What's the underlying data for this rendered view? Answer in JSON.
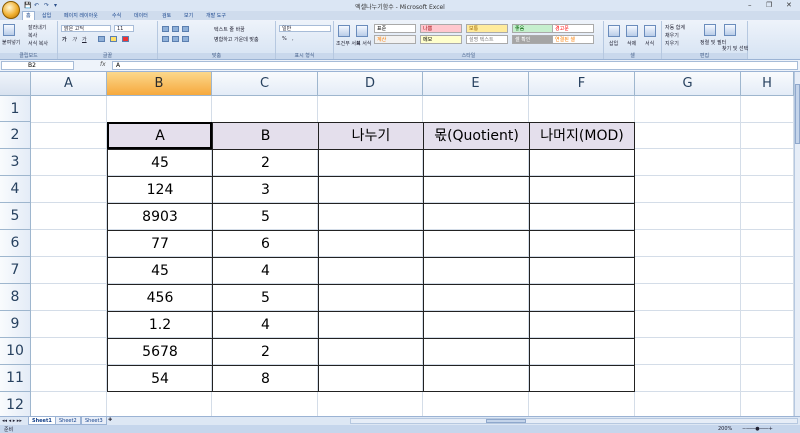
{
  "window": {
    "title": "엑셀나누기함수 - Microsoft Excel",
    "controls": [
      "–",
      "❐",
      "✕"
    ]
  },
  "quick_access": [
    "💾",
    "↶",
    "↷",
    "▾"
  ],
  "ribbon_tabs": [
    "홈",
    "삽입",
    "페이지 레이아웃",
    "수식",
    "데이터",
    "검토",
    "보기",
    "개발 도구"
  ],
  "active_tab": "홈",
  "ribbon": {
    "clipboard": {
      "label": "클립보드",
      "paste": "붙여넣기",
      "cut": "잘라내기",
      "copy": "복사",
      "format_painter": "서식 복사"
    },
    "font": {
      "label": "글꼴",
      "font_name": "맑은 고딕",
      "font_size": "11",
      "bold": "가",
      "italic": "가",
      "underline": "가"
    },
    "alignment": {
      "label": "맞춤",
      "wrap": "텍스트 줄 바꿈",
      "merge": "병합하고 가운데 맞춤"
    },
    "number": {
      "label": "표시 형식",
      "format": "일반",
      "percent": "%",
      "comma": ","
    },
    "styles": {
      "label": "스타일",
      "conditional": "조건부 서식",
      "table": "표 서식",
      "cells": [
        {
          "text": "표준",
          "bg": "#ffffff",
          "fg": "#000000"
        },
        {
          "text": "나쁨",
          "bg": "#ffc7ce",
          "fg": "#9c0006"
        },
        {
          "text": "보통",
          "bg": "#ffeb9c",
          "fg": "#9c6500"
        },
        {
          "text": "좋음",
          "bg": "#c6efce",
          "fg": "#006100"
        },
        {
          "text": "경고문",
          "bg": "#ffffff",
          "fg": "#ff0000"
        },
        {
          "text": "계산",
          "bg": "#f2f2f2",
          "fg": "#fa7d00"
        },
        {
          "text": "메모",
          "bg": "#ffffcc",
          "fg": "#000000"
        },
        {
          "text": "설명 텍스트",
          "bg": "#ffffff",
          "fg": "#7f7f7f"
        },
        {
          "text": "셀 확인",
          "bg": "#a5a5a5",
          "fg": "#ffffff"
        },
        {
          "text": "연결된 셀",
          "bg": "#ffffff",
          "fg": "#fa7d00"
        }
      ]
    },
    "cells": {
      "label": "셀",
      "insert": "삽입",
      "delete": "삭제",
      "format": "서식"
    },
    "editing": {
      "label": "편집",
      "autosum": "자동 합계",
      "fill": "채우기",
      "clear": "지우기",
      "sort": "정렬 및 필터",
      "find": "찾기 및 선택"
    }
  },
  "formula_bar": {
    "name_box": "B2",
    "fx": "fx",
    "formula": "A"
  },
  "columns": [
    "A",
    "B",
    "C",
    "D",
    "E",
    "F",
    "G",
    "H"
  ],
  "selected_column": "B",
  "rows": [
    "1",
    "2",
    "3",
    "4",
    "5",
    "6",
    "7",
    "8",
    "9",
    "10",
    "11",
    "12"
  ],
  "table": {
    "headers": [
      "A",
      "B",
      "나누기",
      "몫(Quotient)",
      "나머지(MOD)"
    ],
    "rows": [
      [
        "45",
        "2",
        "",
        "",
        ""
      ],
      [
        "124",
        "3",
        "",
        "",
        ""
      ],
      [
        "8903",
        "5",
        "",
        "",
        ""
      ],
      [
        "77",
        "6",
        "",
        "",
        ""
      ],
      [
        "45",
        "4",
        "",
        "",
        ""
      ],
      [
        "456",
        "5",
        "",
        "",
        ""
      ],
      [
        "1.2",
        "4",
        "",
        "",
        ""
      ],
      [
        "5678",
        "2",
        "",
        "",
        ""
      ],
      [
        "54",
        "8",
        "",
        "",
        ""
      ]
    ],
    "header_bg": "#e4dfec"
  },
  "sheet_tabs": [
    "Sheet1",
    "Sheet2",
    "Sheet3"
  ],
  "active_sheet": "Sheet1",
  "status": {
    "mode": "준비",
    "zoom": "200%"
  }
}
